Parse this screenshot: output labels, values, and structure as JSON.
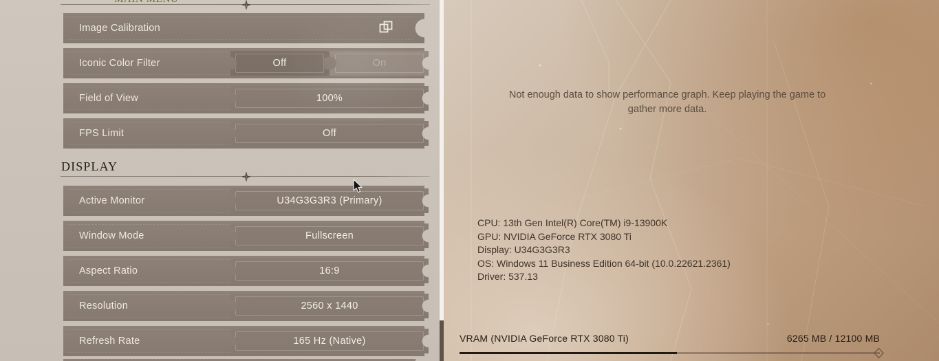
{
  "left_panel": {
    "cut_section_label": "MAIN MENU",
    "graphics_rows": [
      {
        "label": "Image Calibration",
        "type": "link",
        "icon": "external-window-icon"
      },
      {
        "label": "Iconic Color Filter",
        "type": "toggle",
        "options": [
          "Off",
          "On"
        ],
        "selected": "Off"
      },
      {
        "label": "Field of View",
        "type": "value",
        "value": "100%"
      },
      {
        "label": "FPS Limit",
        "type": "value",
        "value": "Off"
      }
    ],
    "display_section": {
      "title": "DISPLAY",
      "rows": [
        {
          "label": "Active Monitor",
          "value": "U34G3G3R3 (Primary)"
        },
        {
          "label": "Window Mode",
          "value": "Fullscreen"
        },
        {
          "label": "Aspect Ratio",
          "value": "16:9"
        },
        {
          "label": "Resolution",
          "value": "2560 x 1440"
        },
        {
          "label": "Refresh Rate",
          "value": "165 Hz (Native)"
        }
      ]
    }
  },
  "right_panel": {
    "no_data_message": "Not enough data to show performance graph. Keep playing the game to gather more data.",
    "system_info": [
      "CPU: 13th Gen Intel(R) Core(TM) i9-13900K",
      "GPU: NVIDIA GeForce RTX 3080 Ti",
      "Display: U34G3G3R3",
      "OS: Windows 11 Business Edition 64-bit (10.0.22621.2361)",
      "Driver: 537.13"
    ],
    "vram": {
      "label": "VRAM (NVIDIA GeForce RTX 3080 Ti)",
      "amount": "6265 MB / 12100 MB",
      "used_mb": 6265,
      "total_mb": 12100,
      "percent": 51.8
    }
  },
  "colors": {
    "row_fill": "#8a7e74",
    "pill_selected": "#7a6e65",
    "panel_left_bg": "#cbc3b9",
    "accent_dark": "#211a13",
    "label_text": "#efe9e1"
  }
}
